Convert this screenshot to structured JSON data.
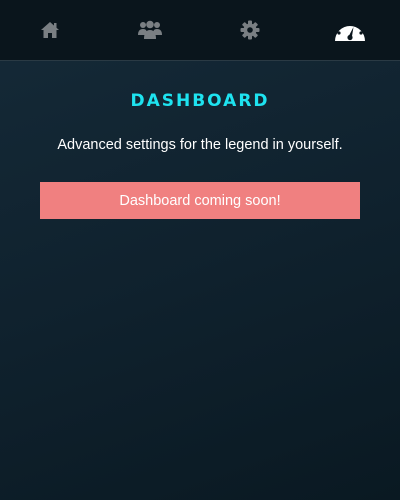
{
  "nav": {
    "items": [
      {
        "icon": "home-icon",
        "active": false
      },
      {
        "icon": "users-icon",
        "active": false
      },
      {
        "icon": "gear-icon",
        "active": false
      },
      {
        "icon": "dashboard-gauge-icon",
        "active": true
      }
    ],
    "active_color": "#ffffff",
    "inactive_color": "#7a7f83"
  },
  "page": {
    "title": "DASHBOARD",
    "subtitle": "Advanced settings for the legend in yourself.",
    "alert": "Dashboard coming soon!"
  },
  "colors": {
    "accent": "#1ee3f0",
    "alert_background": "#f08080",
    "topbar_background": "#0a151c"
  }
}
